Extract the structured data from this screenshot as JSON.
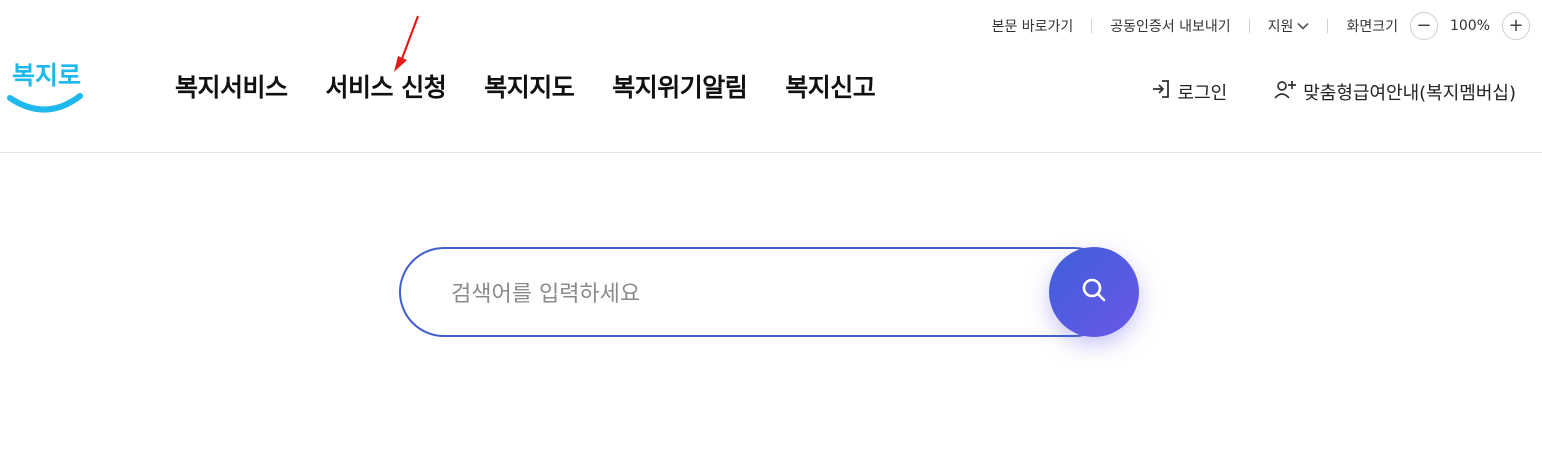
{
  "utility": {
    "skip_to_content": "본문 바로가기",
    "export_certificate": "공동인증서 내보내기",
    "support": "지원",
    "screen_size_label": "화면크기",
    "zoom_out": "−",
    "zoom_level": "100%",
    "zoom_in": "+"
  },
  "logo": {
    "text": "복지로"
  },
  "nav": {
    "items": [
      {
        "label": "복지서비스"
      },
      {
        "label": "서비스 신청"
      },
      {
        "label": "복지지도"
      },
      {
        "label": "복지위기알림"
      },
      {
        "label": "복지신고"
      }
    ]
  },
  "auth": {
    "login": "로그인",
    "membership": "맞춤형급여안내(복지멤버십)"
  },
  "search": {
    "placeholder": "검색어를 입력하세요",
    "value": ""
  },
  "colors": {
    "logo_sky": "#1fb8ec",
    "search_border": "#3f5fd1",
    "search_button_start": "#3f5fd9",
    "search_button_end": "#6a57e8",
    "annotation_arrow": "#e31b1b"
  },
  "icons": {
    "support_toggle": "chevron-down-icon",
    "login": "login-arrow-icon",
    "membership": "user-plus-icon",
    "search": "search-icon"
  }
}
